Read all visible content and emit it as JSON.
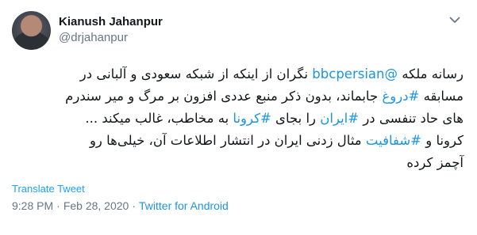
{
  "author": {
    "display_name": "Kianush Jahanpur",
    "handle": "@drjahanpur"
  },
  "tweet": {
    "lines": [
      [
        {
          "t": "رسانه ملکه ",
          "link": false
        },
        {
          "t": "@bbcpersian",
          "link": true
        },
        {
          "t": " نگران از اینکه از شبکه سعودی و آلبانی در",
          "link": false
        }
      ],
      [
        {
          "t": "مسابقه ",
          "link": false
        },
        {
          "t": "#دروغ",
          "link": true
        },
        {
          "t": " جابماند، بدون ذکر منبع عددی افزون بر مرگ و میر سندرم",
          "link": false
        }
      ],
      [
        {
          "t": "های حاد تنفسی در ",
          "link": false
        },
        {
          "t": "#ایران",
          "link": true
        },
        {
          "t": " را بجای ",
          "link": false
        },
        {
          "t": "#کرونا",
          "link": true
        },
        {
          "t": " به مخاطب، غالب میکند ...",
          "link": false
        }
      ],
      [
        {
          "t": "کرونا و ",
          "link": false
        },
        {
          "t": "#شفافیت",
          "link": true
        },
        {
          "t": " مثال زدنی ایران در انتشار اطلاعات آن، خیلی‌ها رو",
          "link": false
        }
      ],
      [
        {
          "t": "آچمز کرده",
          "link": false
        }
      ]
    ],
    "translate_label": "Translate Tweet",
    "time": "9:28 PM",
    "date": "Feb 28, 2020",
    "separator": "·",
    "source": "Twitter for Android"
  },
  "icons": {
    "caret": "chevron-down-icon",
    "avatar": "profile-photo"
  },
  "colors": {
    "link": "#1b95e0",
    "muted": "#657786",
    "text": "#14171a"
  }
}
